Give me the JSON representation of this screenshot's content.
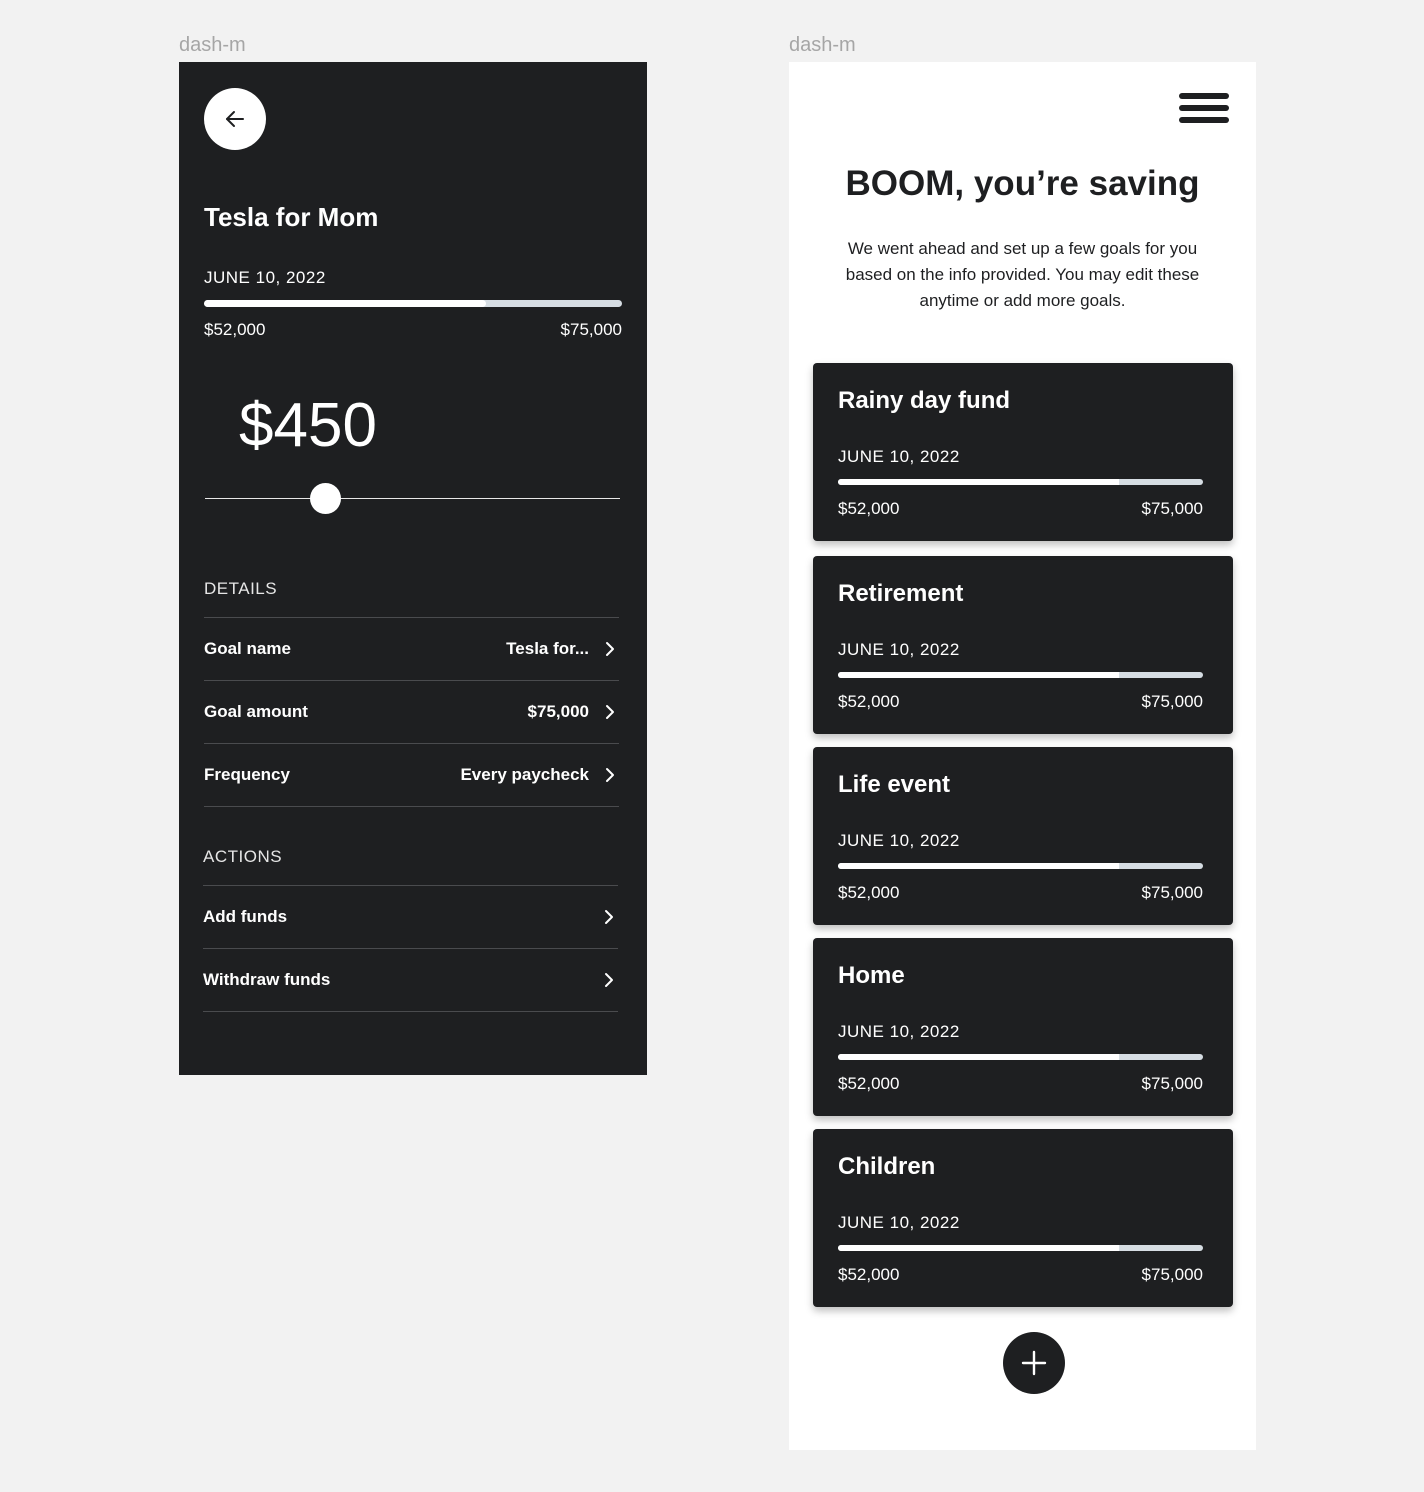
{
  "frames": {
    "left_label": "dash-m",
    "right_label": "dash-m"
  },
  "detail": {
    "title": "Tesla for Mom",
    "date": "JUNE 10, 2022",
    "progress": 0.675,
    "current_amount": "$52,000",
    "target_amount": "$75,000",
    "contribution": "$450",
    "slider_value": 0.29,
    "details_label": "DETAILS",
    "details": [
      {
        "label": "Goal name",
        "value": "Tesla for..."
      },
      {
        "label": "Goal amount",
        "value": "$75,000"
      },
      {
        "label": "Frequency",
        "value": "Every paycheck"
      }
    ],
    "actions_label": "ACTIONS",
    "actions": [
      {
        "label": "Add funds"
      },
      {
        "label": "Withdraw funds"
      }
    ]
  },
  "goals_screen": {
    "title": "BOOM, you’re saving",
    "subtitle": "We went ahead and set up a few goals for you based on the info provided. You may edit these anytime or add more goals.",
    "goals": [
      {
        "name": "Rainy day fund",
        "date": "JUNE 10, 2022",
        "current": "$52,000",
        "target": "$75,000",
        "progress": 0.77
      },
      {
        "name": "Retirement",
        "date": "JUNE 10, 2022",
        "current": "$52,000",
        "target": "$75,000",
        "progress": 0.77
      },
      {
        "name": "Life event",
        "date": "JUNE 10, 2022",
        "current": "$52,000",
        "target": "$75,000",
        "progress": 0.77
      },
      {
        "name": "Home",
        "date": "JUNE 10, 2022",
        "current": "$52,000",
        "target": "$75,000",
        "progress": 0.77
      },
      {
        "name": "Children",
        "date": "JUNE 10, 2022",
        "current": "$52,000",
        "target": "$75,000",
        "progress": 0.77
      }
    ]
  },
  "icons": {
    "back": "arrow-left-icon",
    "chevron": "chevron-right-icon",
    "menu": "hamburger-menu-icon",
    "add": "plus-icon"
  },
  "colors": {
    "dark": "#1e1f21",
    "track": "#d6dde3",
    "page": "#f2f2f2"
  }
}
